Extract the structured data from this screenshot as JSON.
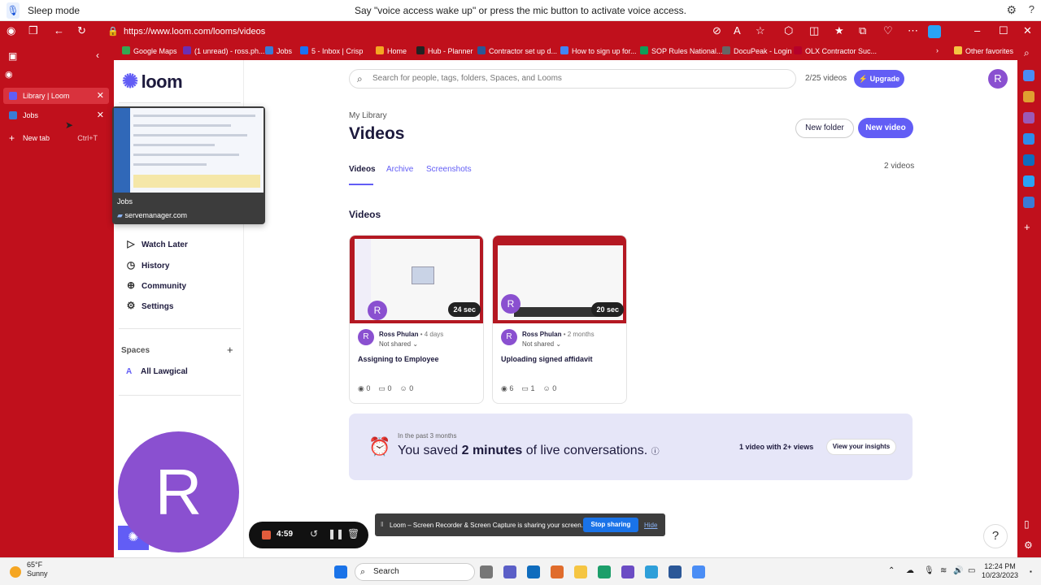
{
  "voice": {
    "mode": "Sleep mode",
    "message": "Say \"voice access wake up\" or press the mic button to activate voice access."
  },
  "browser": {
    "url": "https://www.loom.com/looms/videos",
    "theme_color": "#c0101c",
    "favorites": [
      {
        "label": "Google Maps",
        "color": "#34a853"
      },
      {
        "label": "(1 unread) - ross.ph...",
        "color": "#6b2fb3"
      },
      {
        "label": "Jobs",
        "color": "#3a7bd5"
      },
      {
        "label": "5 - Inbox | Crisp",
        "color": "#1972f5"
      },
      {
        "label": "Home",
        "color": "#f5a623"
      },
      {
        "label": "Hub - Planner",
        "color": "#222222"
      },
      {
        "label": "Contractor set up d...",
        "color": "#2b5797"
      },
      {
        "label": "How to sign up for...",
        "color": "#4285f4"
      },
      {
        "label": "SOP Rules National...",
        "color": "#0f9d58"
      },
      {
        "label": "DocuPeak - Login",
        "color": "#666666"
      },
      {
        "label": "OLX Contractor Suc...",
        "color": "#b5002a"
      },
      {
        "label": "Other favorites",
        "color": "#f5c542"
      }
    ],
    "vertical_tabs": [
      {
        "label": "Library | Loom",
        "active": true
      },
      {
        "label": "Jobs",
        "active": false
      }
    ],
    "new_tab": {
      "label": "New tab",
      "shortcut": "Ctrl+T"
    }
  },
  "preview": {
    "title": "Jobs",
    "url": "servemanager.com"
  },
  "loom": {
    "brand": "loom",
    "accent": "#625df5",
    "nav": [
      {
        "label": "Watch Later",
        "icon": "watch-later-icon"
      },
      {
        "label": "History",
        "icon": "history-icon"
      },
      {
        "label": "Community",
        "icon": "globe-icon"
      },
      {
        "label": "Settings",
        "icon": "gear-icon"
      }
    ],
    "spaces_label": "Spaces",
    "space_item": {
      "badge": "A",
      "label": "All Lawgical"
    },
    "search_placeholder": "Search for people, tags, folders, Spaces, and Looms",
    "video_quota": "2/25 videos",
    "upgrade_label": "Upgrade",
    "user_initial": "R",
    "breadcrumb": "My Library",
    "page_title": "Videos",
    "new_folder": "New folder",
    "new_video": "New video",
    "tabs": [
      "Videos",
      "Archive",
      "Screenshots"
    ],
    "video_count": "2 videos",
    "section_heading": "Videos",
    "videos": [
      {
        "duration": "24 sec",
        "owner": "Ross Phulan",
        "age": "4 days",
        "sharing": "Not shared",
        "title": "Assigning to Employee",
        "views": "0",
        "comments": "0",
        "reactions": "0"
      },
      {
        "duration": "20 sec",
        "owner": "Ross Phulan",
        "age": "2 months",
        "sharing": "Not shared",
        "title": "Uploading signed affidavit",
        "views": "6",
        "comments": "1",
        "reactions": "0"
      }
    ],
    "insights": {
      "period": "In the past 3 months",
      "saved_prefix": "You saved ",
      "saved_amount": "2 minutes",
      "saved_suffix": " of live conversations.",
      "stat": "1 video with 2+ views",
      "cta": "View your insights"
    },
    "help": "?"
  },
  "recorder": {
    "time": "4:59",
    "share_text": "Loom – Screen Recorder & Screen Capture is sharing your screen.",
    "stop_label": "Stop sharing",
    "hide_label": "Hide"
  },
  "taskbar": {
    "temp": "65°F",
    "condition": "Sunny",
    "search": "Search",
    "time": "12:24 PM",
    "date": "10/23/2023"
  }
}
